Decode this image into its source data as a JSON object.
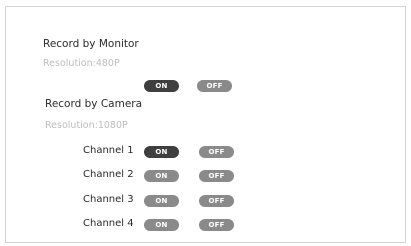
{
  "monitor": {
    "title": "Record by Monitor",
    "resolution": "Resolution:480P",
    "on_label": "ON",
    "off_label": "OFF",
    "selected": "ON"
  },
  "camera": {
    "title": "Record by Camera",
    "resolution": "Resolution:1080P",
    "channels": [
      {
        "label": "Channel 1",
        "on_label": "ON",
        "off_label": "OFF",
        "selected": "ON"
      },
      {
        "label": "Channel 2",
        "on_label": "ON",
        "off_label": "OFF"
      },
      {
        "label": "Channel 3",
        "on_label": "ON",
        "off_label": "OFF"
      },
      {
        "label": "Channel 4",
        "on_label": "ON",
        "off_label": "OFF"
      }
    ]
  },
  "colors": {
    "pill_selected": "#3f3f3f",
    "pill_unselected": "#8a8a8a",
    "resolution_text": "#bdbdbd"
  }
}
